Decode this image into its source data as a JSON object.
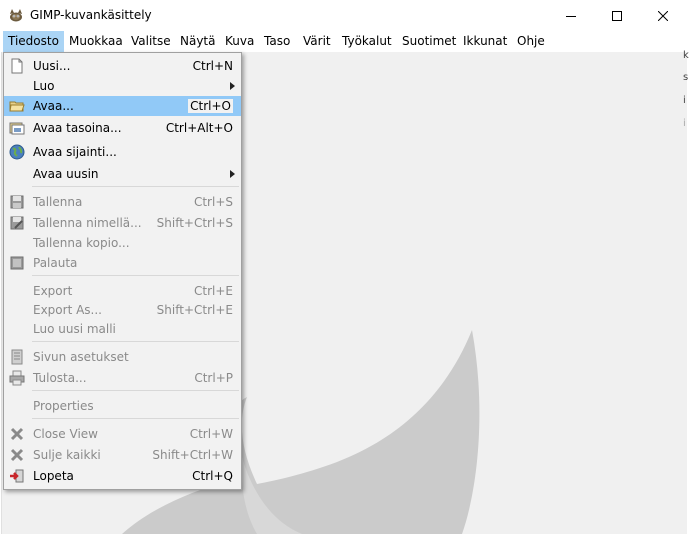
{
  "window": {
    "title": "GIMP-kuvankäsittely",
    "icons": [
      "gimp-app-icon",
      "minimize-icon",
      "maximize-icon",
      "close-icon"
    ]
  },
  "menubar": {
    "items": [
      "Tiedosto",
      "Muokkaa",
      "Valitse",
      "Näytä",
      "Kuva",
      "Taso",
      "Värit",
      "Työkalut",
      "Suotimet",
      "Ikkunat",
      "Ohje"
    ],
    "active": "Tiedosto"
  },
  "file_menu": {
    "items": [
      {
        "label": "Uusi...",
        "accel": "Ctrl+N",
        "icon": "new-document-icon",
        "enabled": true
      },
      {
        "label": "Luo",
        "accel": "",
        "submenu": true,
        "enabled": true
      },
      {
        "label": "Avaa...",
        "accel": "Ctrl+O",
        "icon": "open-folder-icon",
        "enabled": true,
        "highlighted": true
      },
      {
        "label": "Avaa tasoina...",
        "accel": "Ctrl+Alt+O",
        "icon": "open-as-layers-icon",
        "enabled": true
      },
      {
        "label": "Avaa sijainti...",
        "accel": "",
        "icon": "globe-icon",
        "enabled": true
      },
      {
        "label": "Avaa uusin",
        "accel": "",
        "submenu": true,
        "enabled": true
      },
      {
        "label": "Tallenna",
        "accel": "Ctrl+S",
        "icon": "save-icon",
        "enabled": false
      },
      {
        "label": "Tallenna nimellä...",
        "accel": "Shift+Ctrl+S",
        "icon": "save-as-icon",
        "enabled": false
      },
      {
        "label": "Tallenna kopio...",
        "accel": "",
        "enabled": false
      },
      {
        "label": "Palauta",
        "accel": "",
        "icon": "revert-icon",
        "enabled": false
      },
      {
        "label": "Export",
        "accel": "Ctrl+E",
        "enabled": false
      },
      {
        "label": "Export As...",
        "accel": "Shift+Ctrl+E",
        "enabled": false
      },
      {
        "label": "Luo uusi malli",
        "accel": "",
        "enabled": false
      },
      {
        "label": "Sivun asetukset",
        "accel": "",
        "icon": "page-setup-icon",
        "enabled": false
      },
      {
        "label": "Tulosta...",
        "accel": "Ctrl+P",
        "icon": "print-icon",
        "enabled": false
      },
      {
        "label": "Properties",
        "accel": "",
        "enabled": false
      },
      {
        "label": "Close View",
        "accel": "Ctrl+W",
        "icon": "close-view-icon",
        "enabled": false
      },
      {
        "label": "Sulje kaikki",
        "accel": "Shift+Ctrl+W",
        "icon": "close-all-icon",
        "enabled": false
      },
      {
        "label": "Lopeta",
        "accel": "Ctrl+Q",
        "icon": "quit-icon",
        "enabled": true
      }
    ]
  },
  "edge_chars": [
    "k",
    "s",
    "i",
    "i"
  ],
  "colors": {
    "menu_highlight": "#91c9f7",
    "menubar_active": "#aad4f5",
    "canvas_bg": "#f0f0f0",
    "wilber": "#cbcbcb"
  }
}
